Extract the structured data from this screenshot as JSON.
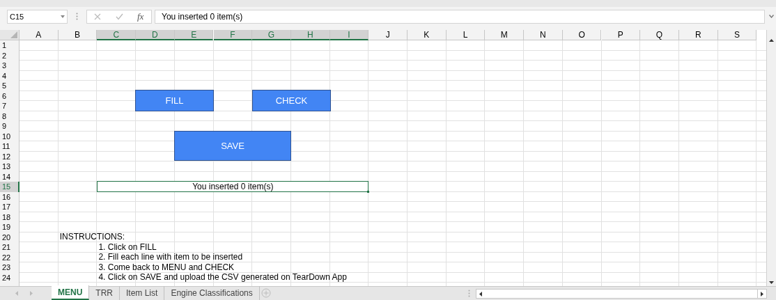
{
  "name_box": {
    "value": "C15"
  },
  "formula_bar": {
    "function_button": "fx",
    "value": "You inserted 0 item(s)"
  },
  "columns": [
    {
      "label": "A",
      "selected": false
    },
    {
      "label": "B",
      "selected": false
    },
    {
      "label": "C",
      "selected": true
    },
    {
      "label": "D",
      "selected": true
    },
    {
      "label": "E",
      "selected": true
    },
    {
      "label": "F",
      "selected": true
    },
    {
      "label": "G",
      "selected": true
    },
    {
      "label": "H",
      "selected": true
    },
    {
      "label": "I",
      "selected": true
    },
    {
      "label": "J",
      "selected": false
    },
    {
      "label": "K",
      "selected": false
    },
    {
      "label": "L",
      "selected": false
    },
    {
      "label": "M",
      "selected": false
    },
    {
      "label": "N",
      "selected": false
    },
    {
      "label": "O",
      "selected": false
    },
    {
      "label": "P",
      "selected": false
    },
    {
      "label": "Q",
      "selected": false
    },
    {
      "label": "R",
      "selected": false
    },
    {
      "label": "S",
      "selected": false
    }
  ],
  "rows": [
    {
      "label": "1",
      "selected": false
    },
    {
      "label": "2",
      "selected": false
    },
    {
      "label": "3",
      "selected": false
    },
    {
      "label": "4",
      "selected": false
    },
    {
      "label": "5",
      "selected": false
    },
    {
      "label": "6",
      "selected": false
    },
    {
      "label": "7",
      "selected": false
    },
    {
      "label": "8",
      "selected": false
    },
    {
      "label": "9",
      "selected": false
    },
    {
      "label": "10",
      "selected": false
    },
    {
      "label": "11",
      "selected": false
    },
    {
      "label": "12",
      "selected": false
    },
    {
      "label": "13",
      "selected": false
    },
    {
      "label": "14",
      "selected": false
    },
    {
      "label": "15",
      "selected": true
    },
    {
      "label": "16",
      "selected": false
    },
    {
      "label": "17",
      "selected": false
    },
    {
      "label": "18",
      "selected": false
    },
    {
      "label": "19",
      "selected": false
    },
    {
      "label": "20",
      "selected": false
    },
    {
      "label": "21",
      "selected": false
    },
    {
      "label": "22",
      "selected": false
    },
    {
      "label": "23",
      "selected": false
    },
    {
      "label": "24",
      "selected": false
    }
  ],
  "status_cell": {
    "text": "You inserted 0 item(s)",
    "selected": true
  },
  "instructions": {
    "heading": "INSTRUCTIONS:",
    "steps": [
      "1. Click on FILL",
      "2. Fill each line with item to be inserted",
      "3. Come back to MENU and CHECK",
      "4. Click on SAVE and upload the CSV generated on TearDown App"
    ]
  },
  "shapes": [
    {
      "label": "FILL"
    },
    {
      "label": "CHECK"
    },
    {
      "label": "SAVE"
    }
  ],
  "sheet_tabs": [
    {
      "label": "MENU",
      "selected": true
    },
    {
      "label": "TRR",
      "selected": false
    },
    {
      "label": "Item List",
      "selected": false
    },
    {
      "label": "Engine Classifications",
      "selected": false
    }
  ]
}
